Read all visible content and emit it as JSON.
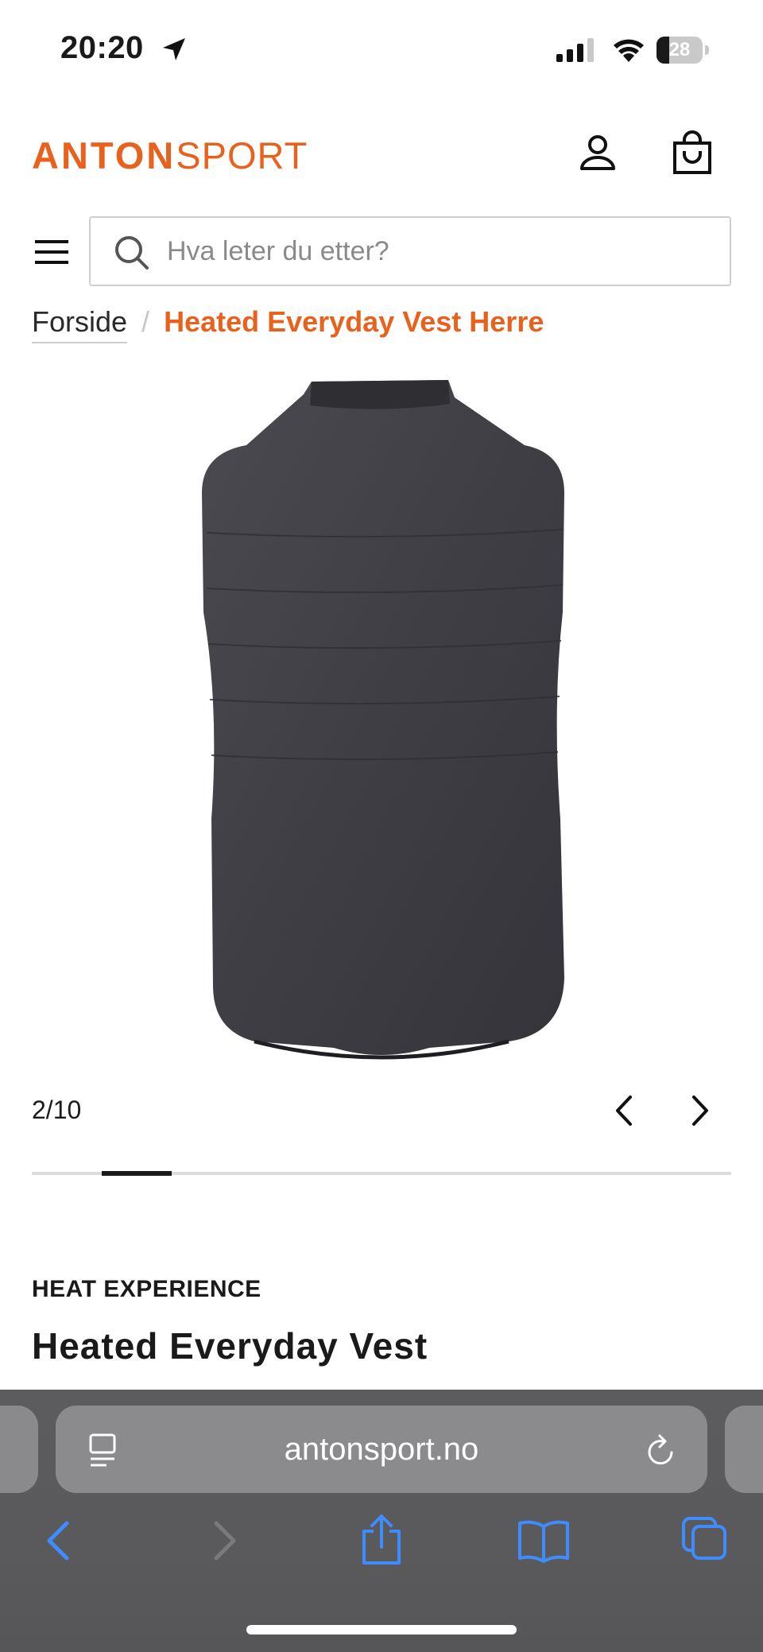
{
  "status_bar": {
    "time": "20:20",
    "battery_level": "28",
    "battery_fraction": 0.28,
    "icons": [
      "location-arrow-icon",
      "signal-bars-icon",
      "wifi-icon",
      "battery-icon"
    ]
  },
  "header": {
    "logo_primary": "ANTON",
    "logo_secondary": "SPORT",
    "brand_color": "#e8621e",
    "icons": [
      "account-icon",
      "shopping-bag-icon",
      "hamburger-menu-icon",
      "search-icon"
    ]
  },
  "search": {
    "placeholder": "Hva leter du etter?",
    "value": ""
  },
  "breadcrumb": {
    "home": "Forside",
    "separator": "/",
    "current": "Heated Everyday Vest Herre"
  },
  "gallery": {
    "counter": "2/10",
    "current_index": 2,
    "total": 10,
    "image_description_icon": "vest-back-image",
    "prev_icon": "chevron-left-icon",
    "next_icon": "chevron-right-icon"
  },
  "product": {
    "brand": "HEAT EXPERIENCE",
    "title": "Heated Everyday Vest"
  },
  "browser": {
    "url": "antonsport.no",
    "icons": [
      "page-menu-icon",
      "reload-icon",
      "back-icon",
      "forward-icon",
      "share-icon",
      "bookmarks-icon",
      "tabs-icon"
    ],
    "accent_color": "#3f8cff"
  }
}
